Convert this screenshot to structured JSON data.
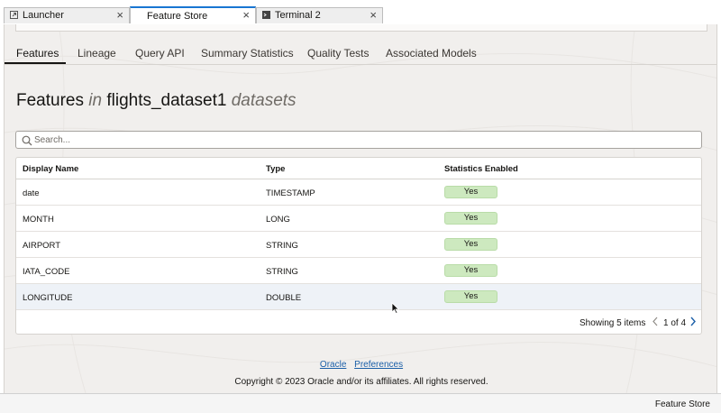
{
  "tabs": [
    {
      "label": "Launcher",
      "icon": "launcher-icon",
      "active": false
    },
    {
      "label": "Feature Store",
      "icon": "",
      "active": true
    },
    {
      "label": "Terminal 2",
      "icon": "terminal-icon",
      "active": false
    }
  ],
  "nav": {
    "items": [
      "Features",
      "Lineage",
      "Query API",
      "Summary Statistics",
      "Quality Tests",
      "Associated Models"
    ],
    "active": "Features"
  },
  "title": {
    "main": "Features",
    "in_word": "in",
    "dataset": "flights_dataset1",
    "suffix": "datasets"
  },
  "search": {
    "placeholder": "Search...",
    "value": ""
  },
  "table": {
    "columns": [
      "Display Name",
      "Type",
      "Statistics Enabled"
    ],
    "rows": [
      {
        "name": "date",
        "type": "TIMESTAMP",
        "stats": "Yes"
      },
      {
        "name": "MONTH",
        "type": "LONG",
        "stats": "Yes"
      },
      {
        "name": "AIRPORT",
        "type": "STRING",
        "stats": "Yes"
      },
      {
        "name": "IATA_CODE",
        "type": "STRING",
        "stats": "Yes"
      },
      {
        "name": "LONGITUDE",
        "type": "DOUBLE",
        "stats": "Yes"
      }
    ],
    "showing": "Showing 5 items",
    "pagination": "1 of 4"
  },
  "footer": {
    "links": [
      "Oracle",
      "Preferences"
    ],
    "copyright": "Copyright © 2023 Oracle and/or its affiliates. All rights reserved."
  },
  "statusbar": {
    "text": "Feature Store"
  },
  "colors": {
    "accent": "#1976d2",
    "badge": "#cde9bf",
    "link": "#1b5fa8",
    "background": "#f1efed"
  }
}
